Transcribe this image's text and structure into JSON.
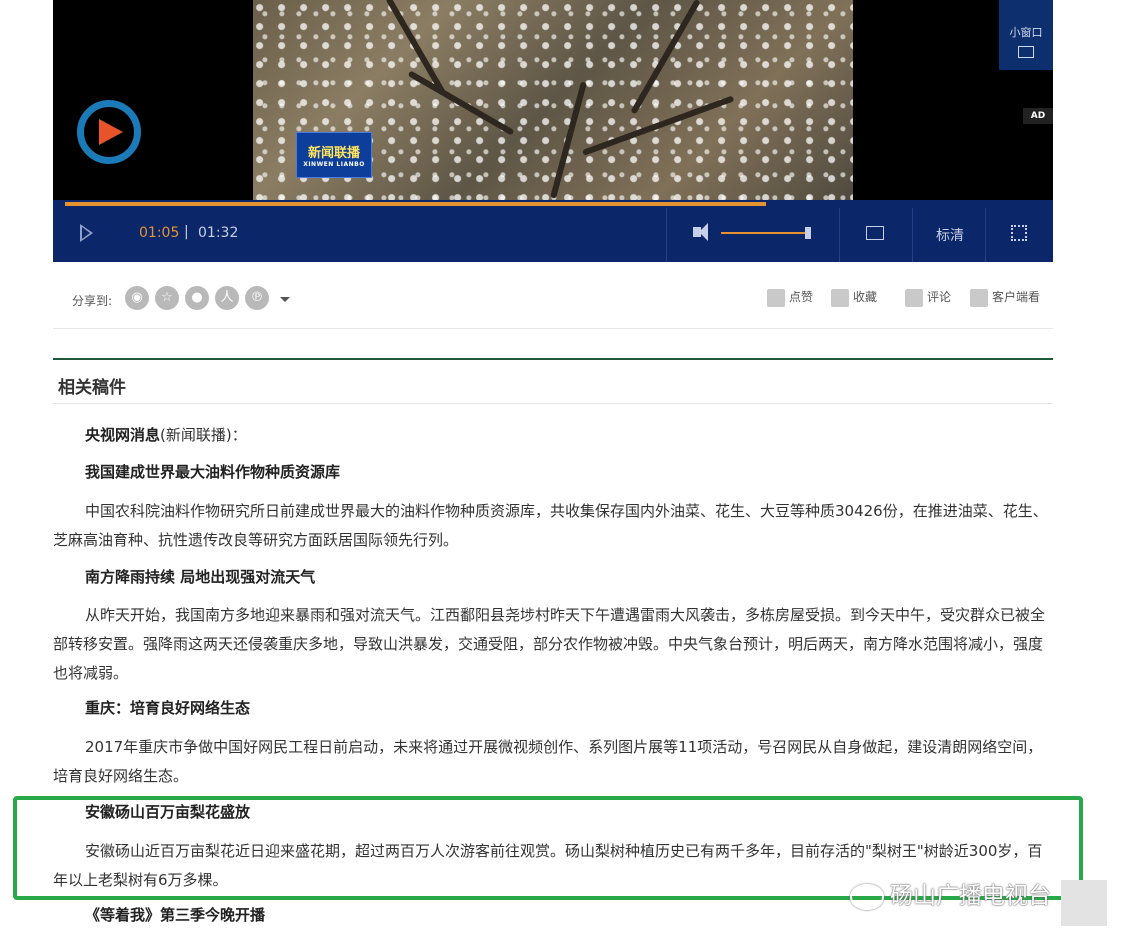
{
  "player": {
    "mini_window_label": "小窗口",
    "ad_label": "AD",
    "news_badge_title": "新闻联播",
    "news_badge_sub": "XINWEN LIANBO",
    "current_time": "01:05",
    "separator": "|",
    "total_time": "01:32",
    "progress_fraction": 0.71,
    "volume_fraction": 0.95,
    "quality_label": "标清",
    "accent_color": "#e59230",
    "bar_color": "#0c2769"
  },
  "share": {
    "label": "分享到:",
    "icons": [
      "weibo-icon",
      "star-icon",
      "wechat-icon",
      "renren-icon",
      "pinterest-icon"
    ],
    "icon_glyphs": [
      "◉",
      "☆",
      "●",
      "人",
      "℗"
    ],
    "actions": [
      {
        "icon": "thumbs-up-icon",
        "label": "点赞"
      },
      {
        "icon": "star-icon",
        "label": "收藏"
      },
      {
        "icon": "comment-icon",
        "label": "评论"
      },
      {
        "icon": "download-icon",
        "label": "客户端看"
      }
    ]
  },
  "related": {
    "title": "相关稿件"
  },
  "article": {
    "source": "央视网消息",
    "source_suffix": "(新闻联播)：",
    "items": [
      {
        "headline": "我国建成世界最大油料作物种质资源库",
        "body": "中国农科院油料作物研究所日前建成世界最大的油料作物种质资源库，共收集保存国内外油菜、花生、大豆等种质30426份，在推进油菜、花生、芝麻高油育种、抗性遗传改良等研究方面跃居国际领先行列。"
      },
      {
        "headline": "南方降雨持续 局地出现强对流天气",
        "body": "从昨天开始，我国南方多地迎来暴雨和强对流天气。江西鄱阳县尧埗村昨天下午遭遇雷雨大风袭击，多栋房屋受损。到今天中午，受灾群众已被全部转移安置。强降雨这两天还侵袭重庆多地，导致山洪暴发，交通受阻，部分农作物被冲毁。中央气象台预计，明后两天，南方降水范围将减小，强度也将减弱。"
      },
      {
        "headline": "重庆：培育良好网络生态",
        "body": "2017年重庆市争做中国好网民工程日前启动，未来将通过开展微视频创作、系列图片展等11项活动，号召网民从自身做起，建设清朗网络空间，培育良好网络生态。"
      },
      {
        "headline": "安徽砀山百万亩梨花盛放",
        "body": "安徽砀山近百万亩梨花近日迎来盛花期，超过两百万人次游客前往观赏。砀山梨树种植历史已有两千多年，目前存活的\"梨树王\"树龄近300岁，百年以上老梨树有6万多棵。"
      }
    ],
    "last_headline": "《等着我》第三季今晚开播"
  },
  "watermark": "砀山广播电视台",
  "highlight_color": "#29a84a"
}
